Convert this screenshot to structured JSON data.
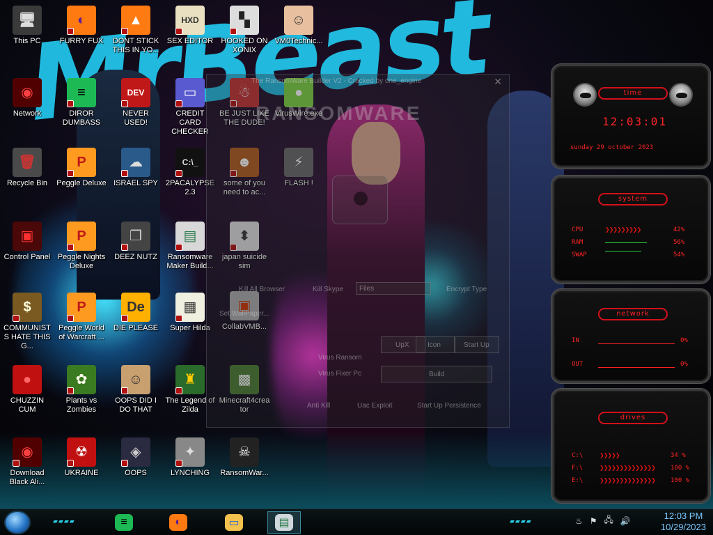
{
  "desktop": {
    "icons": [
      {
        "id": "this-pc",
        "label": "This PC",
        "glyph": "🖥",
        "bg": "#3a3a3a",
        "fg": "#ddd",
        "ov": false
      },
      {
        "id": "network",
        "label": "Network",
        "glyph": "◉",
        "bg": "#500000",
        "fg": "#ff4040",
        "ov": false
      },
      {
        "id": "recycle-bin",
        "label": "Recycle Bin",
        "glyph": "🗑",
        "bg": "#4a4a4a",
        "fg": "#c33",
        "ov": false
      },
      {
        "id": "control-panel",
        "label": "Control Panel",
        "glyph": "▣",
        "bg": "#4a0808",
        "fg": "#ff3030",
        "ov": false
      },
      {
        "id": "communists",
        "label": "COMMUNISTS HATE THIS G...",
        "glyph": "$",
        "bg": "#7a5a20",
        "fg": "#ffd",
        "ov": true
      },
      {
        "id": "chuzzin",
        "label": "CHUZZIN CUM",
        "glyph": "●",
        "bg": "#c01010",
        "fg": "#f66",
        "ov": false
      },
      {
        "id": "download-black",
        "label": "Download Black Ali...",
        "glyph": "◉",
        "bg": "#500000",
        "fg": "#ff4040",
        "ov": true
      },
      {
        "id": "furry-fux",
        "label": "FURRY FUX",
        "glyph": "◐",
        "bg": "#ff7a10",
        "fg": "#5a1a9a",
        "ov": true
      },
      {
        "id": "dior-dumbass",
        "label": "DIROR DUMBASS",
        "glyph": "≡",
        "bg": "#1db954",
        "fg": "#000",
        "ov": true
      },
      {
        "id": "peggle-deluxe",
        "label": "Peggle Deluxe",
        "glyph": "P",
        "bg": "#ff9a20",
        "fg": "#c01818",
        "ov": true
      },
      {
        "id": "peggle-nights",
        "label": "Peggle Nights Deluxe",
        "glyph": "P",
        "bg": "#ff9a20",
        "fg": "#c01818",
        "ov": true
      },
      {
        "id": "peggle-world",
        "label": "Peggle World of Warcraft ...",
        "glyph": "P",
        "bg": "#ff9a20",
        "fg": "#c01818",
        "ov": true
      },
      {
        "id": "plants-vs-zombies",
        "label": "Plants vs Zombies",
        "glyph": "✿",
        "bg": "#3a7a20",
        "fg": "#ffe",
        "ov": true
      },
      {
        "id": "ukraine",
        "label": "UKRAINE",
        "glyph": "☢",
        "bg": "#c01010",
        "fg": "#fff",
        "ov": true
      },
      {
        "id": "dont-stick",
        "label": "DONT STICK THIS IN YO...",
        "glyph": "▲",
        "bg": "#ff7a10",
        "fg": "#fff",
        "ov": true
      },
      {
        "id": "never-used",
        "label": "NEVER USED!",
        "glyph": "DEV",
        "bg": "#c01818",
        "fg": "#fff",
        "ov": true
      },
      {
        "id": "israel-spy",
        "label": "ISRAEL SPY",
        "glyph": "☁",
        "bg": "#2a5a8a",
        "fg": "#ddd",
        "ov": true
      },
      {
        "id": "deez-nutz",
        "label": "DEEZ NUTZ",
        "glyph": "❐",
        "bg": "#444",
        "fg": "#ccc",
        "ov": true
      },
      {
        "id": "die-please",
        "label": "DIE PLEASE",
        "glyph": "De",
        "bg": "#ffb000",
        "fg": "#333",
        "ov": true
      },
      {
        "id": "oops-did-i",
        "label": "OOPS DID I DO THAT",
        "glyph": "☺",
        "bg": "#c8a070",
        "fg": "#333",
        "ov": true
      },
      {
        "id": "oops",
        "label": "OOPS",
        "glyph": "◈",
        "bg": "#2a2a40",
        "fg": "#ccc",
        "ov": true
      },
      {
        "id": "sex-editor",
        "label": "SEX EDITOR",
        "glyph": "HXD",
        "bg": "#e8e0c0",
        "fg": "#333",
        "ov": true
      },
      {
        "id": "credit-card",
        "label": "CREDIT CARD CHECKER",
        "glyph": "▭",
        "bg": "#5a5ad0",
        "fg": "#fff",
        "ov": true
      },
      {
        "id": "2pacalypse",
        "label": "2PACALYPSE 2.3",
        "glyph": "C:\\_",
        "bg": "#111",
        "fg": "#ddd",
        "ov": true
      },
      {
        "id": "ransomware-maker",
        "label": "Ransomware Maker Build...",
        "glyph": "▤",
        "bg": "#d8d8d8",
        "fg": "#2a7a4a",
        "ov": true
      },
      {
        "id": "super-hilda",
        "label": "Super Hilda",
        "glyph": "▦",
        "bg": "#f0f0e0",
        "fg": "#333",
        "ov": true
      },
      {
        "id": "legend-of-zilda",
        "label": "The Legend of Zilda",
        "glyph": "♜",
        "bg": "#2a6a2a",
        "fg": "#fc0",
        "ov": true
      },
      {
        "id": "lynching",
        "label": "LYNCHING",
        "glyph": "✦",
        "bg": "#888",
        "fg": "#ddd",
        "ov": true
      },
      {
        "id": "hooked-on-xonix",
        "label": "HOOKED ON XONIX",
        "glyph": "▚",
        "bg": "#ddd",
        "fg": "#222",
        "ov": true
      },
      {
        "id": "be-just-like",
        "label": "BE JUST LIKE THE DUDE!",
        "glyph": "☃",
        "bg": "#c03030",
        "fg": "#fff",
        "ov": true
      },
      {
        "id": "some-of-you",
        "label": "some of you need to ac...",
        "glyph": "☻",
        "bg": "#b05a1a",
        "fg": "#fff",
        "ov": true
      },
      {
        "id": "japan-suicide",
        "label": "japan suicide sim",
        "glyph": "⬍",
        "bg": "#ddd",
        "fg": "#333",
        "ov": true
      },
      {
        "id": "collab-vmb",
        "label": "CollabVMB...",
        "glyph": "▣",
        "bg": "#aaa",
        "fg": "#c30",
        "ov": false
      },
      {
        "id": "ransomwar",
        "label": "RansomWar...",
        "glyph": "☠",
        "bg": "#222",
        "fg": "#eee",
        "ov": false
      },
      {
        "id": "vm0technic",
        "label": "VM0Technic...",
        "glyph": "☺",
        "bg": "#e8c0a0",
        "fg": "#333",
        "ov": false
      },
      {
        "id": "viruswire",
        "label": "VirusWire.exe",
        "glyph": "●",
        "bg": "#7ad040",
        "fg": "#fff",
        "ov": false
      },
      {
        "id": "flash",
        "label": "FLASH !",
        "glyph": "⚡",
        "bg": "#666",
        "fg": "#fff",
        "ov": false
      },
      {
        "id": "minecraft4creator",
        "label": "Minecraft4creator",
        "glyph": "▩",
        "bg": "#4a7a30",
        "fg": "#fff",
        "ov": false
      }
    ]
  },
  "wallpaper": {
    "brand_text": "MrBeast"
  },
  "builder_window": {
    "title": "The RansomWare Builder V2 - Cracked by one_engine",
    "brand": "RANSOMWARE",
    "kill_browser": "Kill All Browser",
    "kill_skype": "Kill Skype",
    "files_select": "Files",
    "encrypt_type": "Encrypt Type",
    "set_wallpaper": "Set WallPaper...",
    "upx": "UpX",
    "icon": "Icon",
    "startup": "Start Up",
    "virus_ransom": "Virus Ransom",
    "virus_fixer": "Virus Fixer Pc",
    "build": "Build",
    "anti_kill": "Anti Kill",
    "uac_exploit": "Uac Exploit",
    "startup_persistence": "Start Up Persistence"
  },
  "widget": {
    "time_title": "time",
    "time_value": "12:03:01",
    "date_value": "sunday 29 october 2023",
    "system_title": "system",
    "cpu_label": "CPU",
    "cpu_value": "42%",
    "ram_label": "RAM",
    "ram_value": "56%",
    "swap_label": "SWAP",
    "swap_value": "54%",
    "cpu_pct": 0.42,
    "ram_pct": 0.56,
    "swap_pct": 0.54,
    "network_title": "network",
    "in_label": "IN",
    "in_value": "0%",
    "out_label": "OUT",
    "out_value": "0%",
    "drives_title": "drives",
    "drives": [
      {
        "label": "C:\\",
        "value": "34 %",
        "pct": 0.34
      },
      {
        "label": "F:\\",
        "value": "100 %",
        "pct": 1.0
      },
      {
        "label": "E:\\",
        "value": "100 %",
        "pct": 1.0
      }
    ],
    "accent": "#ff2020"
  },
  "taskbar": {
    "pinned": [
      {
        "id": "spotify",
        "icon": "spotify-icon",
        "glyph": "≡",
        "bg": "#1db954",
        "fg": "#000"
      },
      {
        "id": "firefox",
        "icon": "firefox-icon",
        "glyph": "◐",
        "bg": "#ff7a10",
        "fg": "#5a1a9a"
      },
      {
        "id": "file-explorer",
        "icon": "folder-icon",
        "glyph": "▭",
        "bg": "#f2c14e",
        "fg": "#2a6ad0"
      },
      {
        "id": "ransomware-builder",
        "icon": "window-icon",
        "glyph": "▤",
        "bg": "#cfd8dc",
        "fg": "#2a7a4a"
      }
    ],
    "tray": [
      {
        "id": "java",
        "icon": "java-icon",
        "glyph": "♨"
      },
      {
        "id": "action-center",
        "icon": "flag-icon",
        "glyph": "⚑"
      },
      {
        "id": "network-status",
        "icon": "network-icon",
        "glyph": "🖧"
      },
      {
        "id": "volume",
        "icon": "speaker-icon",
        "glyph": "🔊"
      }
    ],
    "clock_time": "12:03 PM",
    "clock_date": "10/29/2023"
  }
}
